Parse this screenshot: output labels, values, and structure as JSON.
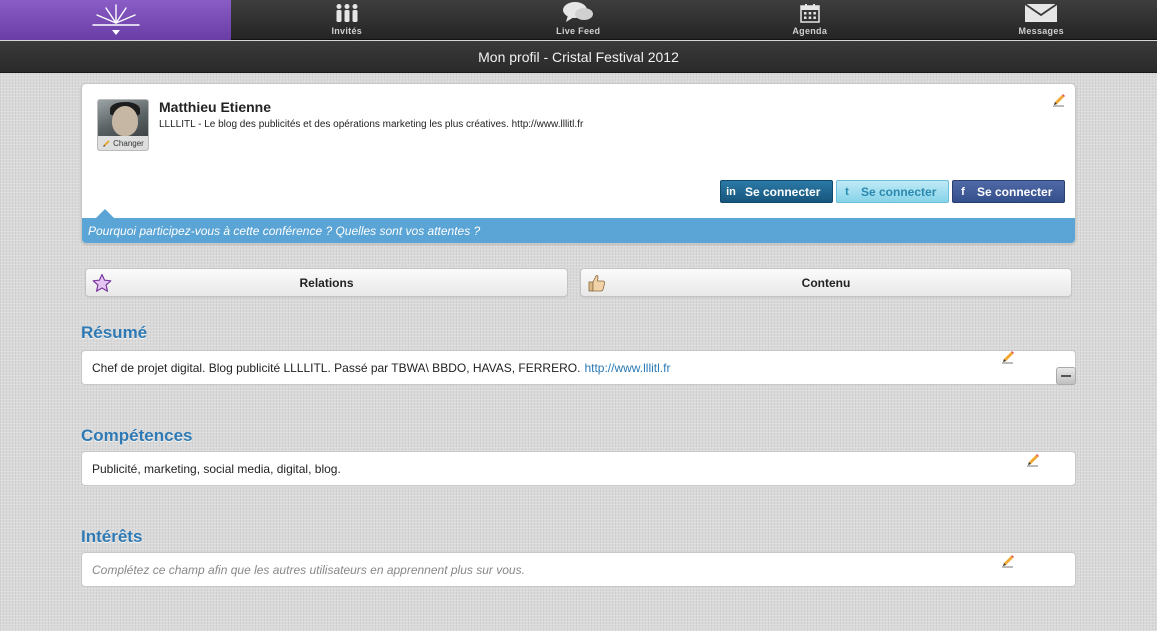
{
  "nav": {
    "items": [
      {
        "label": "Invités",
        "icon": "people-icon"
      },
      {
        "label": "Live Feed",
        "icon": "chat-bubbles-icon"
      },
      {
        "label": "Agenda",
        "icon": "calendar-icon"
      },
      {
        "label": "Messages",
        "icon": "envelope-icon"
      }
    ],
    "home_icon": "crystal-logo-icon",
    "accent_color": "#7a4cb6"
  },
  "titlebar": {
    "title": "Mon profil - Cristal Festival 2012"
  },
  "profile": {
    "name": "Matthieu Etienne",
    "bio": "LLLLITL - Le blog des publicités et des opérations marketing les plus créatives. http://www.lllitl.fr",
    "avatar_change_label": "Changer",
    "social": {
      "linkedin": {
        "icon_text": "in",
        "label": "Se connecter"
      },
      "twitter": {
        "icon_text": "t",
        "label": "Se connecter"
      },
      "facebook": {
        "icon_text": "f",
        "label": "Se connecter"
      }
    },
    "question": "Pourquoi participez-vous à cette conférence ? Quelles sont vos attentes ?"
  },
  "tabs": {
    "relations": {
      "label": "Relations",
      "icon": "star-icon"
    },
    "contenu": {
      "label": "Contenu",
      "icon": "thumbs-up-icon"
    }
  },
  "sections": {
    "resume": {
      "title": "Résumé",
      "text": "Chef de projet digital. Blog publicité LLLLITL. Passé par TBWA\\ BBDO, HAVAS, FERRERO.",
      "link": "http://www.lllitl.fr"
    },
    "competences": {
      "title": "Compétences",
      "text": "Publicité, marketing, social media, digital, blog."
    },
    "interets": {
      "title": "Intérêts",
      "placeholder": "Complétez ce champ afin que les autres utilisateurs en apprennent plus sur vous."
    }
  },
  "colors": {
    "section_title": "#2f7ab4",
    "question_bar": "#5aa4d6",
    "linkedin": "#1f6a95",
    "twitter": "#9adcee",
    "facebook": "#3b5998"
  }
}
